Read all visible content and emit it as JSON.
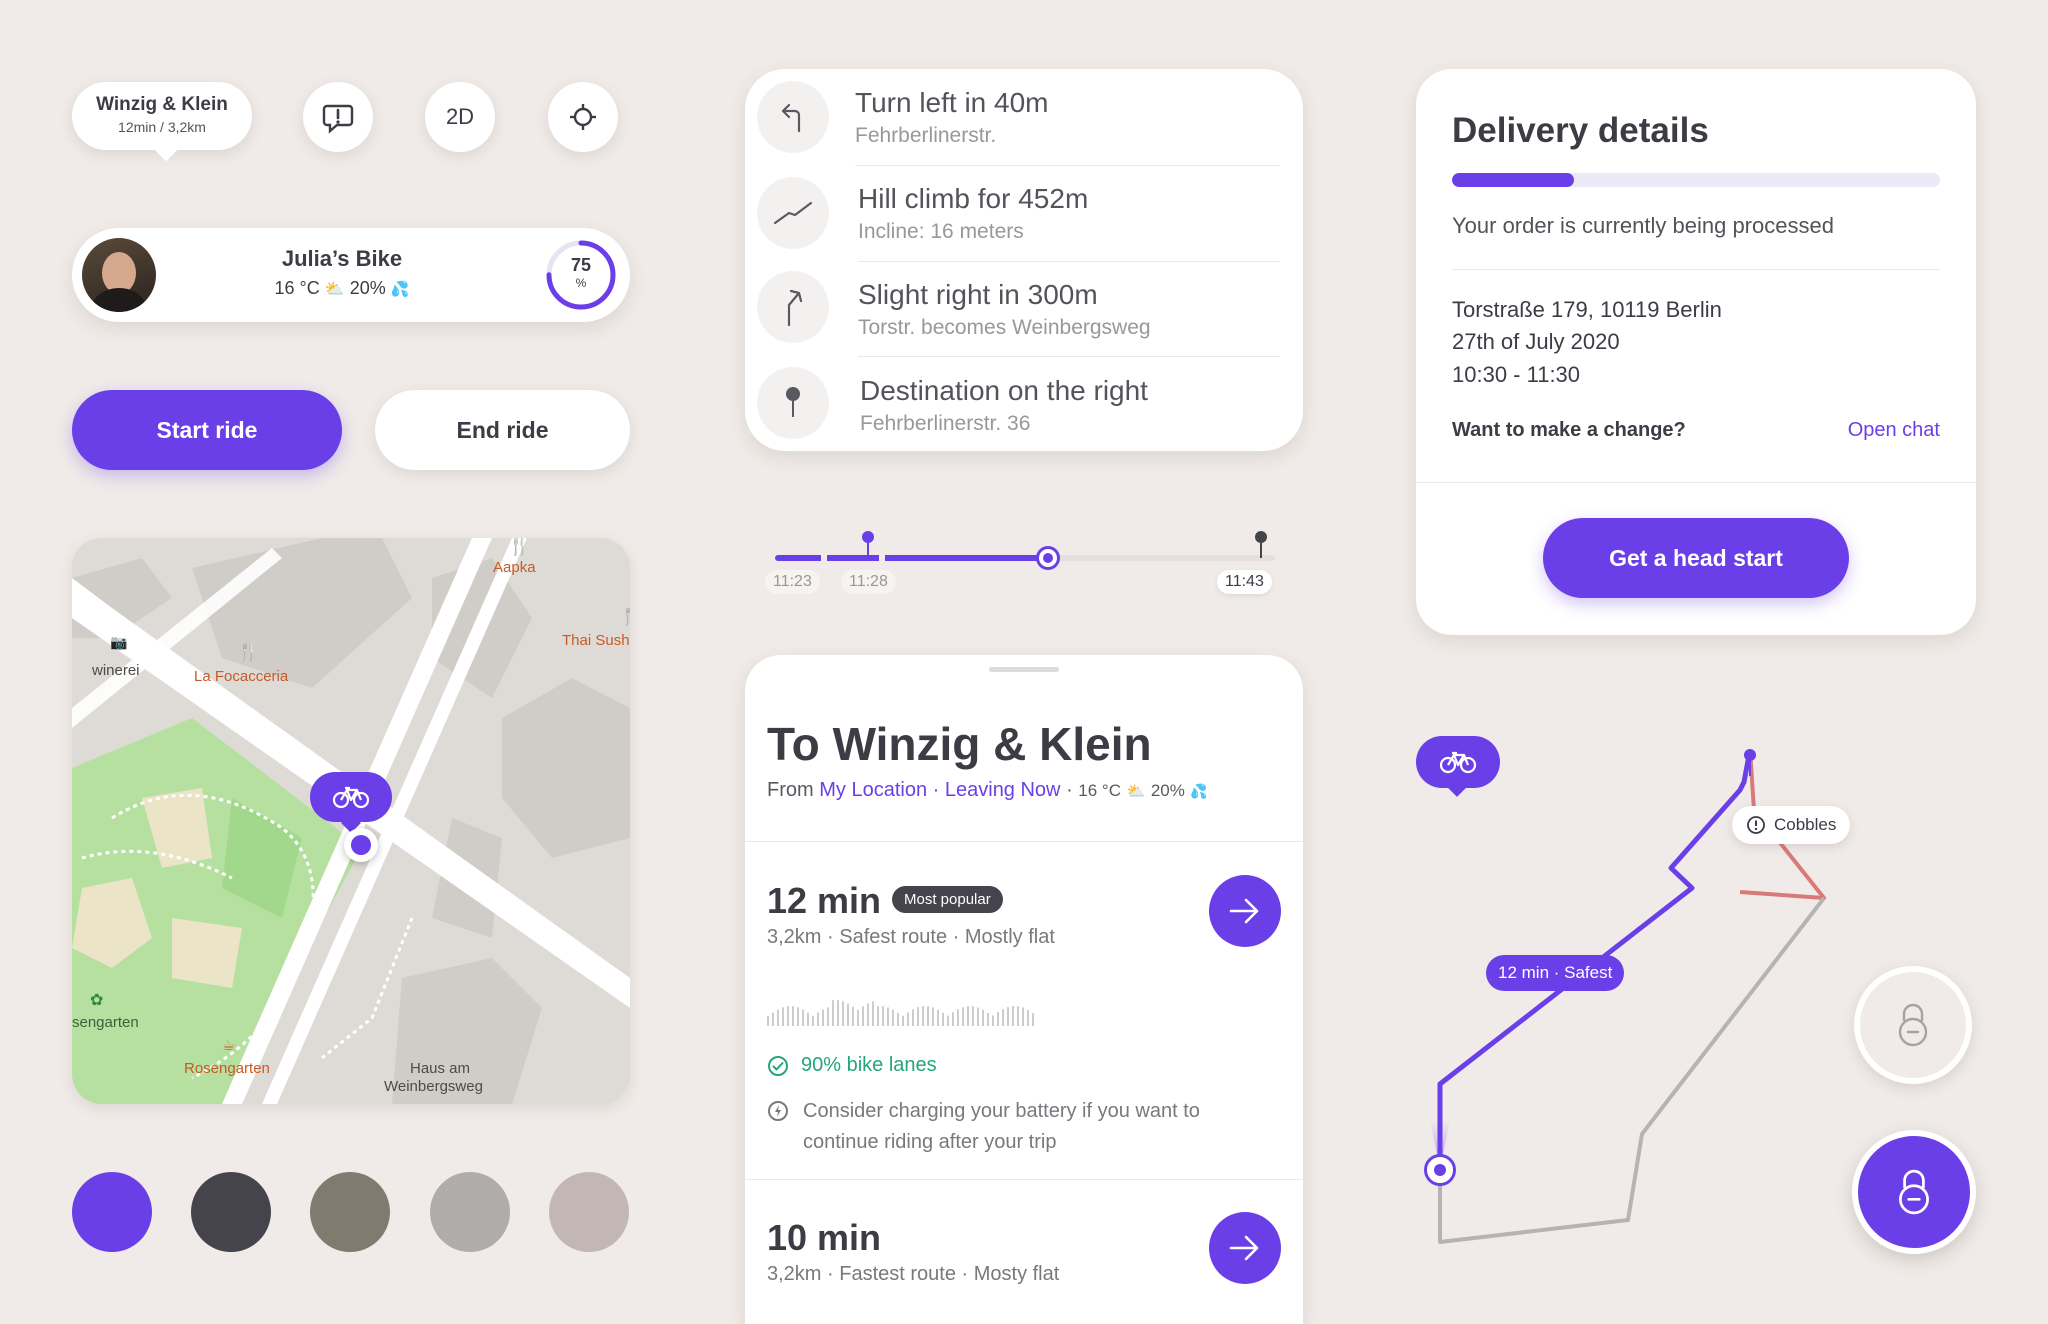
{
  "colors": {
    "accent": "#6b3fe8",
    "dark": "#45434b",
    "olive": "#7f7b6f",
    "stone": "#b0acaa",
    "rose": "#c2b7b4",
    "danger": "#d97a78",
    "success": "#25a57a"
  },
  "destination_bubble": {
    "title": "Winzig & Klein",
    "subtitle": "12min / 3,2km"
  },
  "icon_buttons": [
    {
      "icon": "report-icon"
    },
    {
      "label": "2D"
    },
    {
      "icon": "locate-icon"
    }
  ],
  "bike_status": {
    "name": "Julia’s Bike",
    "temp": "16 °C",
    "rain": "20%",
    "battery": "75",
    "battery_unit": "%",
    "battery_fraction": 0.75
  },
  "buttons": {
    "start": "Start ride",
    "end": "End ride"
  },
  "map": {
    "labels": {
      "aapka": "Aapka",
      "thai": "Thai Sush",
      "winerei": "winerei",
      "focacceria": "La Focacceria",
      "rosengarten_park": "sengarten",
      "rosengarten_cafe": "Rosengarten",
      "haus1": "Haus am",
      "haus2": "Weinbergsweg"
    }
  },
  "swatches": [
    "#6b3fe8",
    "#45434b",
    "#7f7b6f",
    "#b0acaa",
    "#c2b7b4"
  ],
  "directions": [
    {
      "icon": "turn-left-icon",
      "title": "Turn left in 40m",
      "sub": "Fehrberlinerstr."
    },
    {
      "icon": "hill-climb-icon",
      "title": "Hill climb for 452m",
      "sub": "Incline: 16 meters"
    },
    {
      "icon": "slight-right-icon",
      "title": "Slight right in 300m",
      "sub": "Torstr. becomes Weinbergsweg"
    },
    {
      "icon": "destination-pin-icon",
      "title": "Destination on the right",
      "sub": "Fehrberlinerstr. 36"
    }
  ],
  "timeline": {
    "t1": "11:23",
    "t2": "11:28",
    "t3": "11:43",
    "progress": 0.78
  },
  "route_sheet": {
    "title": "To Winzig & Klein",
    "from": "From",
    "location": "My Location",
    "sep": "·",
    "leaving": "Leaving Now",
    "temp": "16 °C",
    "rain": "20%",
    "routes": [
      {
        "time": "12 min",
        "badge": "Most popular",
        "desc": "3,2km · Safest route · Mostly flat",
        "bike_lanes": "90% bike lanes",
        "battery_note_1": "Consider charging your battery if you want to",
        "battery_note_2": "continue riding after your trip"
      },
      {
        "time": "10 min",
        "desc": "3,2km · Fastest route · Mosty flat"
      }
    ]
  },
  "delivery": {
    "title": "Delivery details",
    "progress": 0.25,
    "status": "Your order is currently being processed",
    "address": "Torstraße 179, 10119 Berlin",
    "date": "27th of July 2020",
    "time": "10:30 - 11:30",
    "change_q": "Want to make a change?",
    "chat": "Open chat",
    "cta": "Get a head start"
  },
  "route_map": {
    "tooltip_warning": "Cobbles",
    "route_label": "12 min · Safest"
  }
}
